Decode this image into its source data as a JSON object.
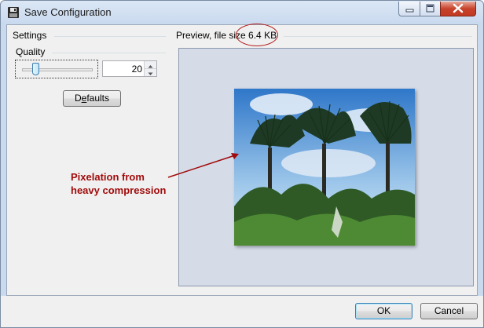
{
  "window": {
    "title": "Save Configuration"
  },
  "settings": {
    "group_label": "Settings",
    "quality_label": "Quality",
    "quality_slider_level": 20,
    "quality_value": "20",
    "defaults_label_pre": "D",
    "defaults_label_underlined": "e",
    "defaults_label_post": "faults"
  },
  "preview": {
    "label_prefix": "Preview, file size",
    "file_size": "6.4 KB"
  },
  "annotation": {
    "line1": "Pixelation from",
    "line2": "heavy compression"
  },
  "footer": {
    "ok_label": "OK",
    "cancel_label": "Cancel"
  },
  "colors": {
    "annotation": "#a10b0b",
    "preview_bg": "#d5dce8",
    "close_button": "#c7432c"
  }
}
